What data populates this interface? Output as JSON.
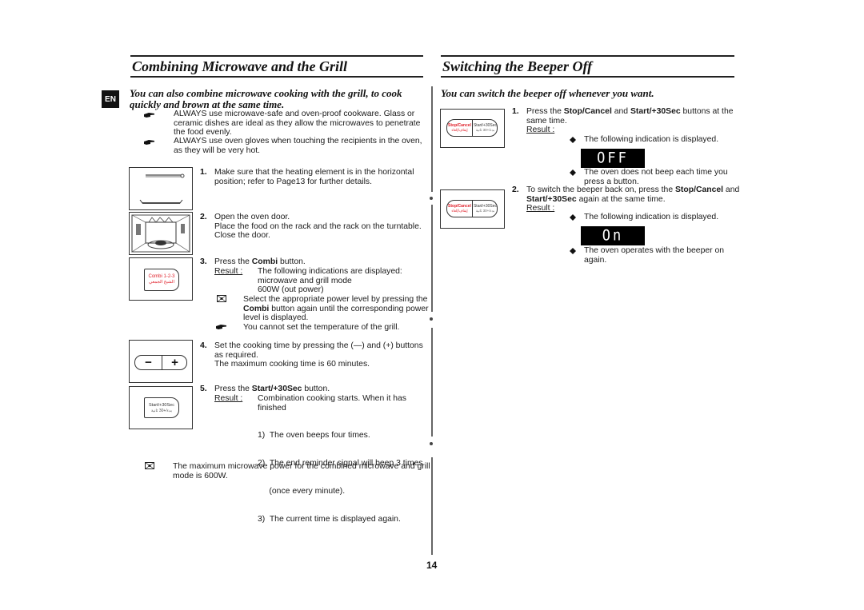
{
  "language_tab": "EN",
  "page_number": "14",
  "left": {
    "title": "Combining Microwave and the Grill",
    "intro_line1": "You can also combine microwave cooking with the grill, to cook",
    "intro_line2": "quickly and brown at the same time.",
    "tips": [
      {
        "icon": "pointing-hand-icon",
        "lines": [
          "ALWAYS use microwave-safe and oven-proof cookware. Glass or",
          "ceramic dishes are ideal as they allow the microwaves to penetrate",
          "the food evenly."
        ]
      },
      {
        "icon": "pointing-hand-icon",
        "lines": [
          "ALWAYS use oven gloves when touching the recipients in the oven,",
          "as they will be very hot."
        ]
      }
    ],
    "steps": [
      {
        "num": "1.",
        "lines": [
          "Make sure that the heating element is in the horizontal",
          "position; refer to Page13 for further details."
        ]
      },
      {
        "num": "2.",
        "lines": [
          "Open the oven door.",
          "Place the food on the rack and the rack on the turntable.",
          "Close the door."
        ]
      },
      {
        "num": "3.",
        "pre": "Press the ",
        "bold": "Combi",
        "post": " button.",
        "result_label": "Result :",
        "result_lines": [
          "The following indications are displayed:",
          "microwave and grill mode",
          "600W (out power)"
        ],
        "note_lines_pre": "Select the appropriate power level by pressing the",
        "note_bold": "Combi",
        "note_mid": " button again until the corresponding power",
        "note_end": "level is displayed.",
        "hand_line": "You cannot set the temperature of the grill."
      },
      {
        "num": "4.",
        "lines": [
          "Set the cooking time by pressing the (—) and (+) buttons",
          "as required.",
          "The maximum cooking time is 60 minutes."
        ]
      },
      {
        "num": "5.",
        "pre": "Press the ",
        "bold": "Start/+30Sec",
        "post": " button.",
        "result_label": "Result :",
        "result_lines": [
          "Combination cooking starts. When it has",
          "finished"
        ],
        "sub_items": [
          "1)  The oven beeps four times.",
          "2)  The end reminder signal will beep 3 times",
          "     (once every minute).",
          "3)  The current time is displayed again."
        ]
      }
    ],
    "footer_note": [
      "The maximum microwave power for the combined microwave and grill",
      "mode is 600W."
    ],
    "illustrations": {
      "combi_button_label": "Combi 1-2-3",
      "combi_button_arabic": "الشيخ الجمعي",
      "minus_label": "−",
      "plus_label": "+",
      "start_label": "Start/+30Sec",
      "start_arabic": "بدء/+30 ثانية"
    }
  },
  "right": {
    "title": "Switching the Beeper Off",
    "intro": "You can switch the beeper off whenever you want.",
    "step1": {
      "num": "1.",
      "line1_pre": "Press the ",
      "line1_b1": "Stop/Cancel",
      "line1_mid": " and ",
      "line1_b2": "Start/+30Sec",
      "line1_post": " buttons at the",
      "line2": "same time.",
      "result_label": "Result :",
      "bullet1": "The following indication is displayed.",
      "display": "OFF",
      "bullet2_l1": "The oven does not beep each time you",
      "bullet2_l2": "press a button."
    },
    "step2": {
      "num": "2.",
      "line1_pre": "To switch the beeper back on, press the ",
      "line1_b1": "Stop/Cancel",
      "line1_post": " and",
      "line2_b": "Start/+30Sec",
      "line2_post": " again at the same time.",
      "result_label": "Result :",
      "bullet1": "The following indication is displayed.",
      "display": "On",
      "bullet2_l1": "The oven operates with the beeper on",
      "bullet2_l2": "again."
    },
    "illustrations": {
      "stop_label": "Stop/Cancel",
      "stop_arabic": "إيقاف/إلغاء",
      "start_label": "Start/+30Sec",
      "start_arabic": "بدء/+30 ثانية"
    }
  },
  "colors": {
    "stop_red": "#e0202a"
  }
}
